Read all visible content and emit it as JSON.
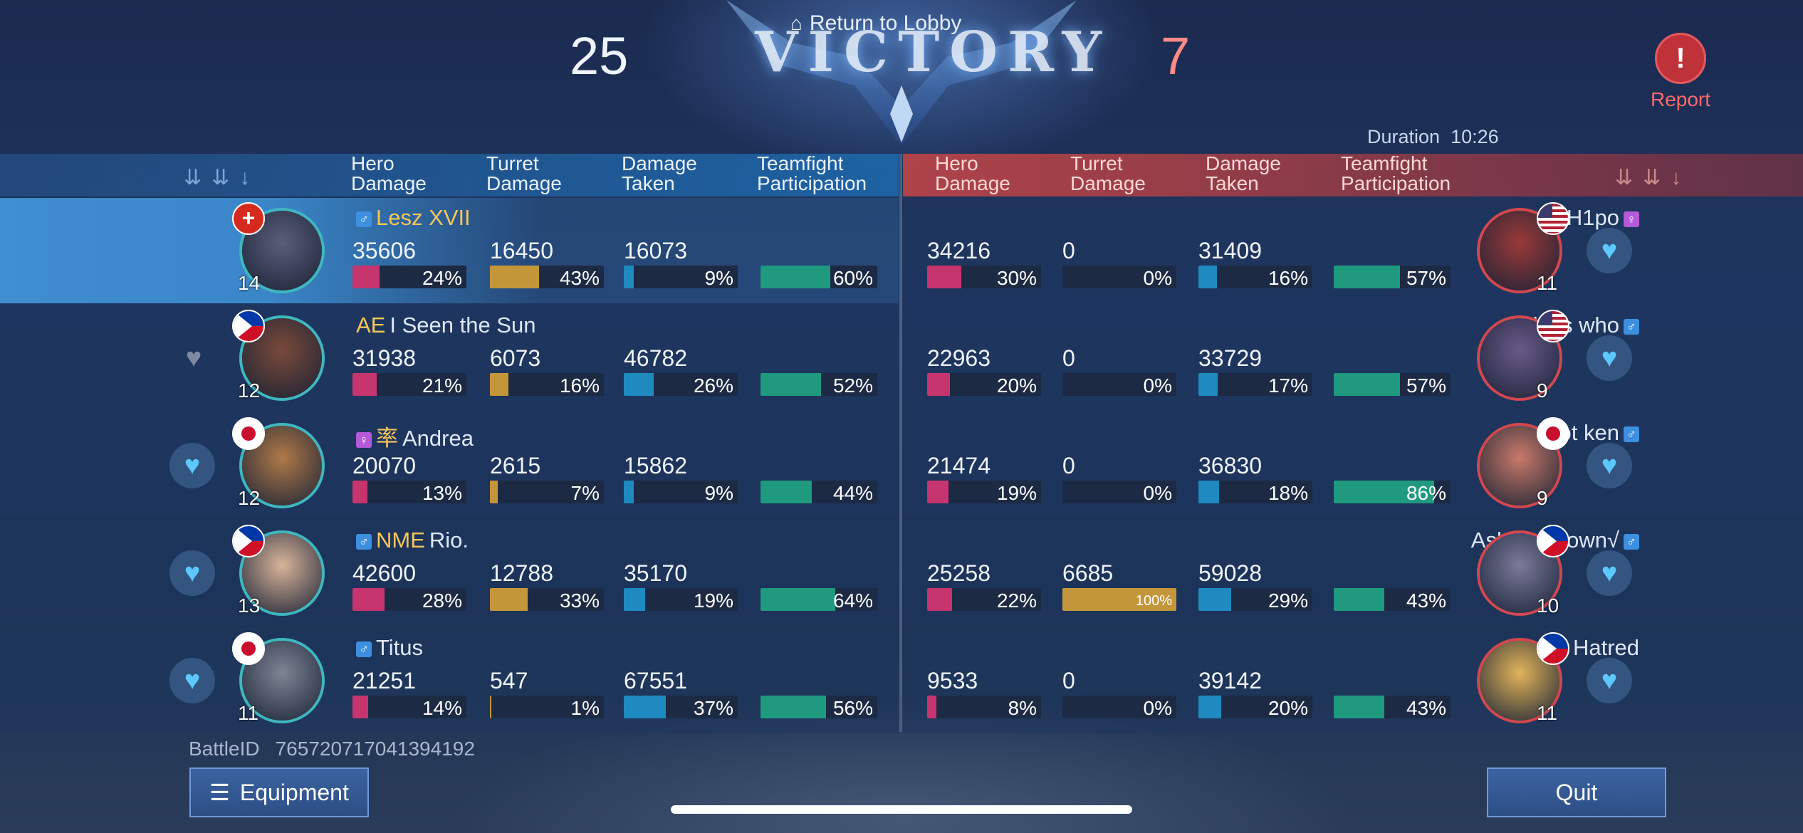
{
  "header": {
    "title": "VICTORY",
    "return_lobby": "Return to Lobby",
    "score_left": "25",
    "score_right": "7",
    "report": "Report",
    "duration_label": "Duration",
    "duration_value": "10:26"
  },
  "columns": {
    "hero_damage": [
      "Hero",
      "Damage"
    ],
    "turret_damage": [
      "Turret",
      "Damage"
    ],
    "damage_taken": [
      "Damage",
      "Taken"
    ],
    "teamfight": [
      "Teamfight",
      "Participation"
    ]
  },
  "colors": {
    "hero_damage": "#c7356e",
    "turret_damage": "#c4963a",
    "damage_taken": "#1e8ac0",
    "teamfight": "#1f9a7e",
    "ally_border": "#3fb7bf",
    "enemy_border": "#d2484f"
  },
  "left_team": [
    {
      "name": "Lesz XVII",
      "tag": "",
      "gender": "♂",
      "level": "14",
      "flag": "switzerland",
      "hd": "35606",
      "hd_pct": "24%",
      "hd_f": 0.24,
      "td": "16450",
      "td_pct": "43%",
      "td_f": 0.43,
      "dt": "16073",
      "dt_pct": "9%",
      "dt_f": 0.09,
      "tp_pct": "60%",
      "tp_f": 0.6
    },
    {
      "name": "I Seen the Sun",
      "tag": "AE",
      "gender": "",
      "level": "12",
      "flag": "philippines",
      "hd": "31938",
      "hd_pct": "21%",
      "hd_f": 0.21,
      "td": "6073",
      "td_pct": "16%",
      "td_f": 0.16,
      "dt": "46782",
      "dt_pct": "26%",
      "dt_f": 0.26,
      "tp_pct": "52%",
      "tp_f": 0.52
    },
    {
      "name": "Andrea",
      "tag": "率",
      "gender": "♀",
      "level": "12",
      "flag": "japan",
      "hd": "20070",
      "hd_pct": "13%",
      "hd_f": 0.13,
      "td": "2615",
      "td_pct": "7%",
      "td_f": 0.07,
      "dt": "15862",
      "dt_pct": "9%",
      "dt_f": 0.09,
      "tp_pct": "44%",
      "tp_f": 0.44
    },
    {
      "name": "Rio.",
      "tag": "NME",
      "gender": "♂",
      "level": "13",
      "flag": "philippines",
      "hd": "42600",
      "hd_pct": "28%",
      "hd_f": 0.28,
      "td": "12788",
      "td_pct": "33%",
      "td_f": 0.33,
      "dt": "35170",
      "dt_pct": "19%",
      "dt_f": 0.19,
      "tp_pct": "64%",
      "tp_f": 0.64
    },
    {
      "name": "Titus",
      "tag": "",
      "gender": "♂",
      "level": "11",
      "flag": "japan",
      "hd": "21251",
      "hd_pct": "14%",
      "hd_f": 0.14,
      "td": "547",
      "td_pct": "1%",
      "td_f": 0.01,
      "dt": "67551",
      "dt_pct": "37%",
      "dt_f": 0.37,
      "tp_pct": "56%",
      "tp_f": 0.56
    }
  ],
  "right_team": [
    {
      "name": "H1po",
      "gender": "♀",
      "level": "11",
      "flag": "usa",
      "hd": "34216",
      "hd_pct": "30%",
      "hd_f": 0.3,
      "td": "0",
      "td_pct": "0%",
      "td_f": 0,
      "dt": "31409",
      "dt_pct": "16%",
      "dt_f": 0.16,
      "tp_pct": "57%",
      "tp_f": 0.57
    },
    {
      "name": "Who's who",
      "gender": "♂",
      "level": "9",
      "flag": "usa",
      "hd": "22963",
      "hd_pct": "20%",
      "hd_f": 0.2,
      "td": "0",
      "td_pct": "0%",
      "td_f": 0,
      "dt": "33729",
      "dt_pct": "17%",
      "dt_f": 0.17,
      "tp_pct": "57%",
      "tp_f": 0.57
    },
    {
      "name": "ur not ken",
      "gender": "♂",
      "level": "9",
      "flag": "japan",
      "hd": "21474",
      "hd_pct": "19%",
      "hd_f": 0.19,
      "td": "0",
      "td_pct": "0%",
      "td_f": 0,
      "dt": "36830",
      "dt_pct": "18%",
      "dt_f": 0.18,
      "tp_pct": "86%",
      "tp_f": 0.86
    },
    {
      "name": "Asl•|Unknown√",
      "gender": "♂",
      "level": "10",
      "flag": "philippines",
      "hd": "25258",
      "hd_pct": "22%",
      "hd_f": 0.22,
      "td": "6685",
      "td_pct": "100%",
      "td_f": 1.0,
      "dt": "59028",
      "dt_pct": "29%",
      "dt_f": 0.29,
      "tp_pct": "43%",
      "tp_f": 0.43
    },
    {
      "name": "Hatred",
      "gender": "",
      "level": "11",
      "flag": "philippines",
      "hd": "9533",
      "hd_pct": "8%",
      "hd_f": 0.08,
      "td": "0",
      "td_pct": "0%",
      "td_f": 0,
      "dt": "39142",
      "dt_pct": "20%",
      "dt_f": 0.2,
      "tp_pct": "43%",
      "tp_f": 0.43
    }
  ],
  "footer": {
    "battle_id_label": "BattleID",
    "battle_id": "765720717041394192",
    "equipment_button": "Equipment",
    "quit_button": "Quit"
  },
  "icons": {
    "return": "home-icon",
    "report": "alert-icon",
    "like": "heart-icon",
    "equipment": "list-icon",
    "sort": "sort-arrows-icon"
  }
}
